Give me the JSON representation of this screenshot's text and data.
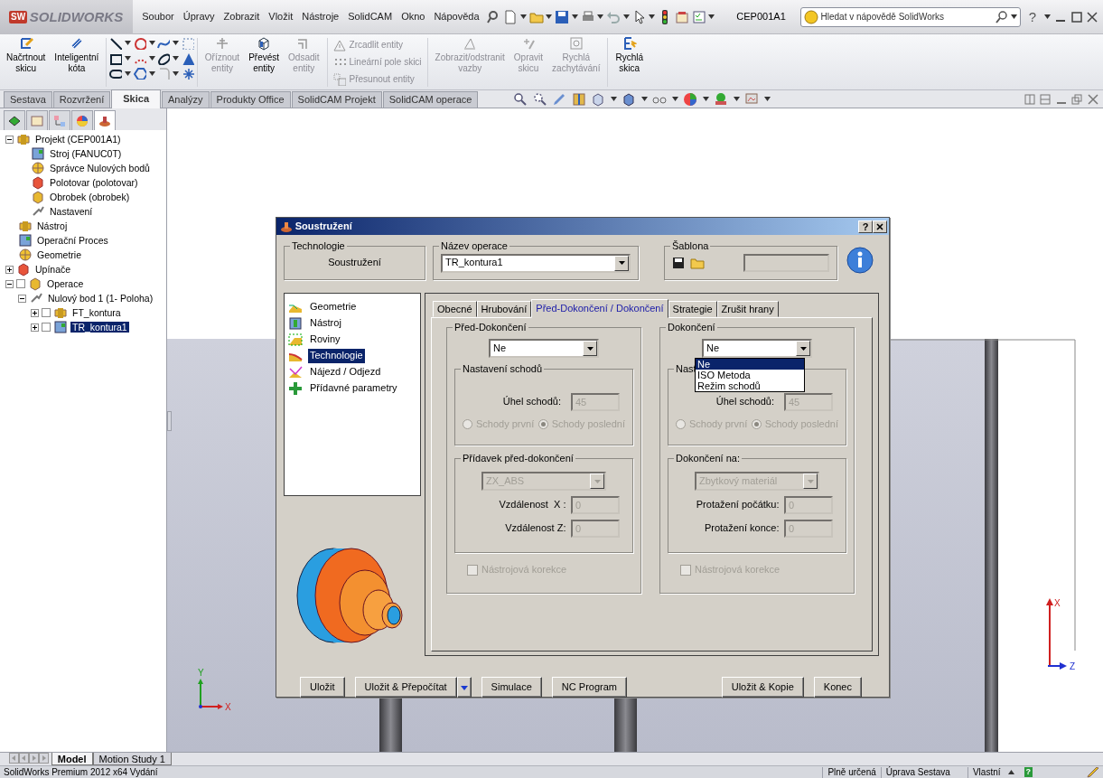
{
  "app": {
    "logo_mark": "SW",
    "logo": "SOLIDWORKS",
    "document_title": "CEP001A1",
    "search": {
      "placeholder": "Hledat v nápovědě SolidWorks"
    },
    "help_glyph": "?"
  },
  "menu": [
    "Soubor",
    "Úpravy",
    "Zobrazit",
    "Vložit",
    "Nástroje",
    "SolidCAM",
    "Okno",
    "Nápověda"
  ],
  "ribbon": [
    {
      "kind": "big",
      "label": "Načrtnout\nskicu",
      "disabled": false
    },
    {
      "kind": "big",
      "label": "Inteligentní\nkóta",
      "disabled": false
    },
    {
      "kind": "tools"
    },
    {
      "kind": "big",
      "label": "Oříznout\nentity",
      "disabled": true
    },
    {
      "kind": "big",
      "label": "Převést\nentity",
      "disabled": false
    },
    {
      "kind": "big",
      "label": "Odsadit\nentity",
      "disabled": true
    },
    {
      "kind": "stack",
      "items": [
        {
          "label": "Zrcadlit entity",
          "disabled": true
        },
        {
          "label": "Lineární pole skici",
          "disabled": true
        },
        {
          "label": "Přesunout entity",
          "disabled": true
        }
      ]
    },
    {
      "kind": "big",
      "label": "Zobrazit/odstranit\nvazby",
      "disabled": true
    },
    {
      "kind": "big",
      "label": "Opravit\nskicu",
      "disabled": true
    },
    {
      "kind": "big",
      "label": "Rychlá\nzachytávání",
      "disabled": true
    },
    {
      "kind": "big",
      "label": "Rychlá\nskica",
      "disabled": false
    }
  ],
  "command_tabs": [
    {
      "label": "Sestava",
      "selected": false
    },
    {
      "label": "Rozvržení",
      "selected": false
    },
    {
      "label": "Skica",
      "selected": true
    },
    {
      "label": "Analýzy",
      "selected": false
    },
    {
      "label": "Produkty Office",
      "selected": false
    },
    {
      "label": "SolidCAM Projekt",
      "selected": false
    },
    {
      "label": "SolidCAM operace",
      "selected": false
    }
  ],
  "tree": [
    {
      "label": "Projekt (CEP001A1)",
      "kind": "branch",
      "expanded": true,
      "selected": false,
      "children": [
        {
          "label": "Stroj (FANUC0T)",
          "kind": "leaf",
          "selected": false
        },
        {
          "label": "Správce Nulových bodů",
          "kind": "leaf",
          "selected": false
        },
        {
          "label": "Polotovar (polotovar)",
          "kind": "leaf",
          "selected": false
        },
        {
          "label": "Obrobek (obrobek)",
          "kind": "leaf",
          "selected": false
        },
        {
          "label": "Nastavení",
          "kind": "leaf",
          "selected": false
        }
      ]
    },
    {
      "label": "Nástroj",
      "kind": "leaf",
      "selected": false
    },
    {
      "label": "Operační Proces",
      "kind": "leaf",
      "selected": false
    },
    {
      "label": "Geometrie",
      "kind": "leaf",
      "selected": false
    },
    {
      "label": "Upínače",
      "kind": "branch",
      "expanded": false,
      "selected": false
    },
    {
      "label": "Operace",
      "kind": "check-branch",
      "expanded": true,
      "checked": false,
      "selected": false,
      "children": [
        {
          "label": "Nulový bod 1 (1- Poloha)",
          "kind": "branch",
          "expanded": true,
          "selected": false,
          "children": [
            {
              "label": "FT_kontura",
              "kind": "check-branch",
              "expanded": false,
              "checked": false,
              "selected": false
            },
            {
              "label": "TR_kontura1",
              "kind": "check-branch",
              "expanded": false,
              "checked": false,
              "selected": true
            }
          ]
        }
      ]
    }
  ],
  "viewport": {
    "axis_labels": [
      "X",
      "Z"
    ],
    "triad_labels": [
      "Y",
      "X"
    ]
  },
  "dialog": {
    "title": "Soustružení",
    "help_button": "?",
    "technology": {
      "title": "Technologie",
      "value": "Soustružení"
    },
    "operation_name": {
      "title": "Název operace",
      "value": "TR_kontura1"
    },
    "template": {
      "title": "Šablona"
    },
    "nav": [
      {
        "label": "Geometrie",
        "selected": false
      },
      {
        "label": "Nástroj",
        "selected": false
      },
      {
        "label": "Roviny",
        "selected": false
      },
      {
        "label": "Technologie",
        "selected": true
      },
      {
        "label": "Nájezd / Odjezd",
        "selected": false
      },
      {
        "label": "Přídavné parametry",
        "selected": false
      }
    ],
    "tabs": [
      {
        "label": "Obecné",
        "selected": false
      },
      {
        "label": "Hrubování",
        "selected": false
      },
      {
        "label": "Před-Dokončení / Dokončení",
        "selected": true
      },
      {
        "label": "Strategie",
        "selected": false
      },
      {
        "label": "Zrušit hrany",
        "selected": false
      }
    ],
    "columns": [
      {
        "title": "Před-Dokončení",
        "select": {
          "value": "Ne"
        },
        "steps": {
          "title": "Nastavení schodů",
          "angle_label": "Úhel schodů:",
          "angle": "45",
          "disabled": true,
          "radios": [
            {
              "label": "Schody první",
              "selected": false
            },
            {
              "label": "Schody poslední",
              "selected": true
            }
          ]
        },
        "second": {
          "title": "Přídavek před-dokončení",
          "select": "ZX_ABS",
          "disabled": true,
          "fields": [
            {
              "label": "Vzdálenost  X :",
              "value": "0"
            },
            {
              "label": "Vzdálenost Z:",
              "value": "0"
            }
          ]
        },
        "compensation": {
          "label": "Nástrojová korekce",
          "checked": false,
          "disabled": true
        }
      },
      {
        "title": "Dokončení",
        "select": {
          "value": "Ne",
          "open": true,
          "options": [
            {
              "label": "Ne",
              "selected": true
            },
            {
              "label": "ISO Metoda",
              "selected": false
            },
            {
              "label": "Režim schodů",
              "selected": false
            }
          ]
        },
        "steps": {
          "title": "Nast",
          "angle_label": "Úhel schodů:",
          "angle": "45",
          "disabled": true,
          "radios": [
            {
              "label": "Schody první",
              "selected": false
            },
            {
              "label": "Schody poslední",
              "selected": true
            }
          ]
        },
        "second": {
          "title": "Dokončení na:",
          "select": "Zbytkový materiál",
          "disabled": true,
          "fields": [
            {
              "label": "Protažení počátku:",
              "value": "0"
            },
            {
              "label": "Protažení konce:",
              "value": "0"
            }
          ]
        },
        "compensation": {
          "label": "Nástrojová korekce",
          "checked": false,
          "disabled": true
        }
      }
    ],
    "buttons_left": [
      {
        "label": "Uložit",
        "kind": "push"
      },
      {
        "label": "Uložit & Přepočítat",
        "kind": "split"
      },
      {
        "label": "Simulace",
        "kind": "push"
      },
      {
        "label": "NC Program",
        "kind": "push"
      }
    ],
    "buttons_right": [
      {
        "label": "Uložit & Kopie",
        "kind": "push"
      },
      {
        "label": "Konec",
        "kind": "push"
      }
    ]
  },
  "panel_tabs": [
    {
      "selected": false
    },
    {
      "selected": false
    },
    {
      "selected": false
    },
    {
      "selected": false
    },
    {
      "selected": true
    }
  ],
  "bottom_tabs": [
    {
      "label": "Model",
      "selected": true
    },
    {
      "label": "Motion Study 1",
      "selected": false
    }
  ],
  "status_bar": {
    "text": "SolidWorks Premium 2012 x64 Vydání",
    "items": [
      "Plně určená",
      "Úprava Sestava",
      "Vlastní"
    ],
    "help_badge": "?"
  }
}
